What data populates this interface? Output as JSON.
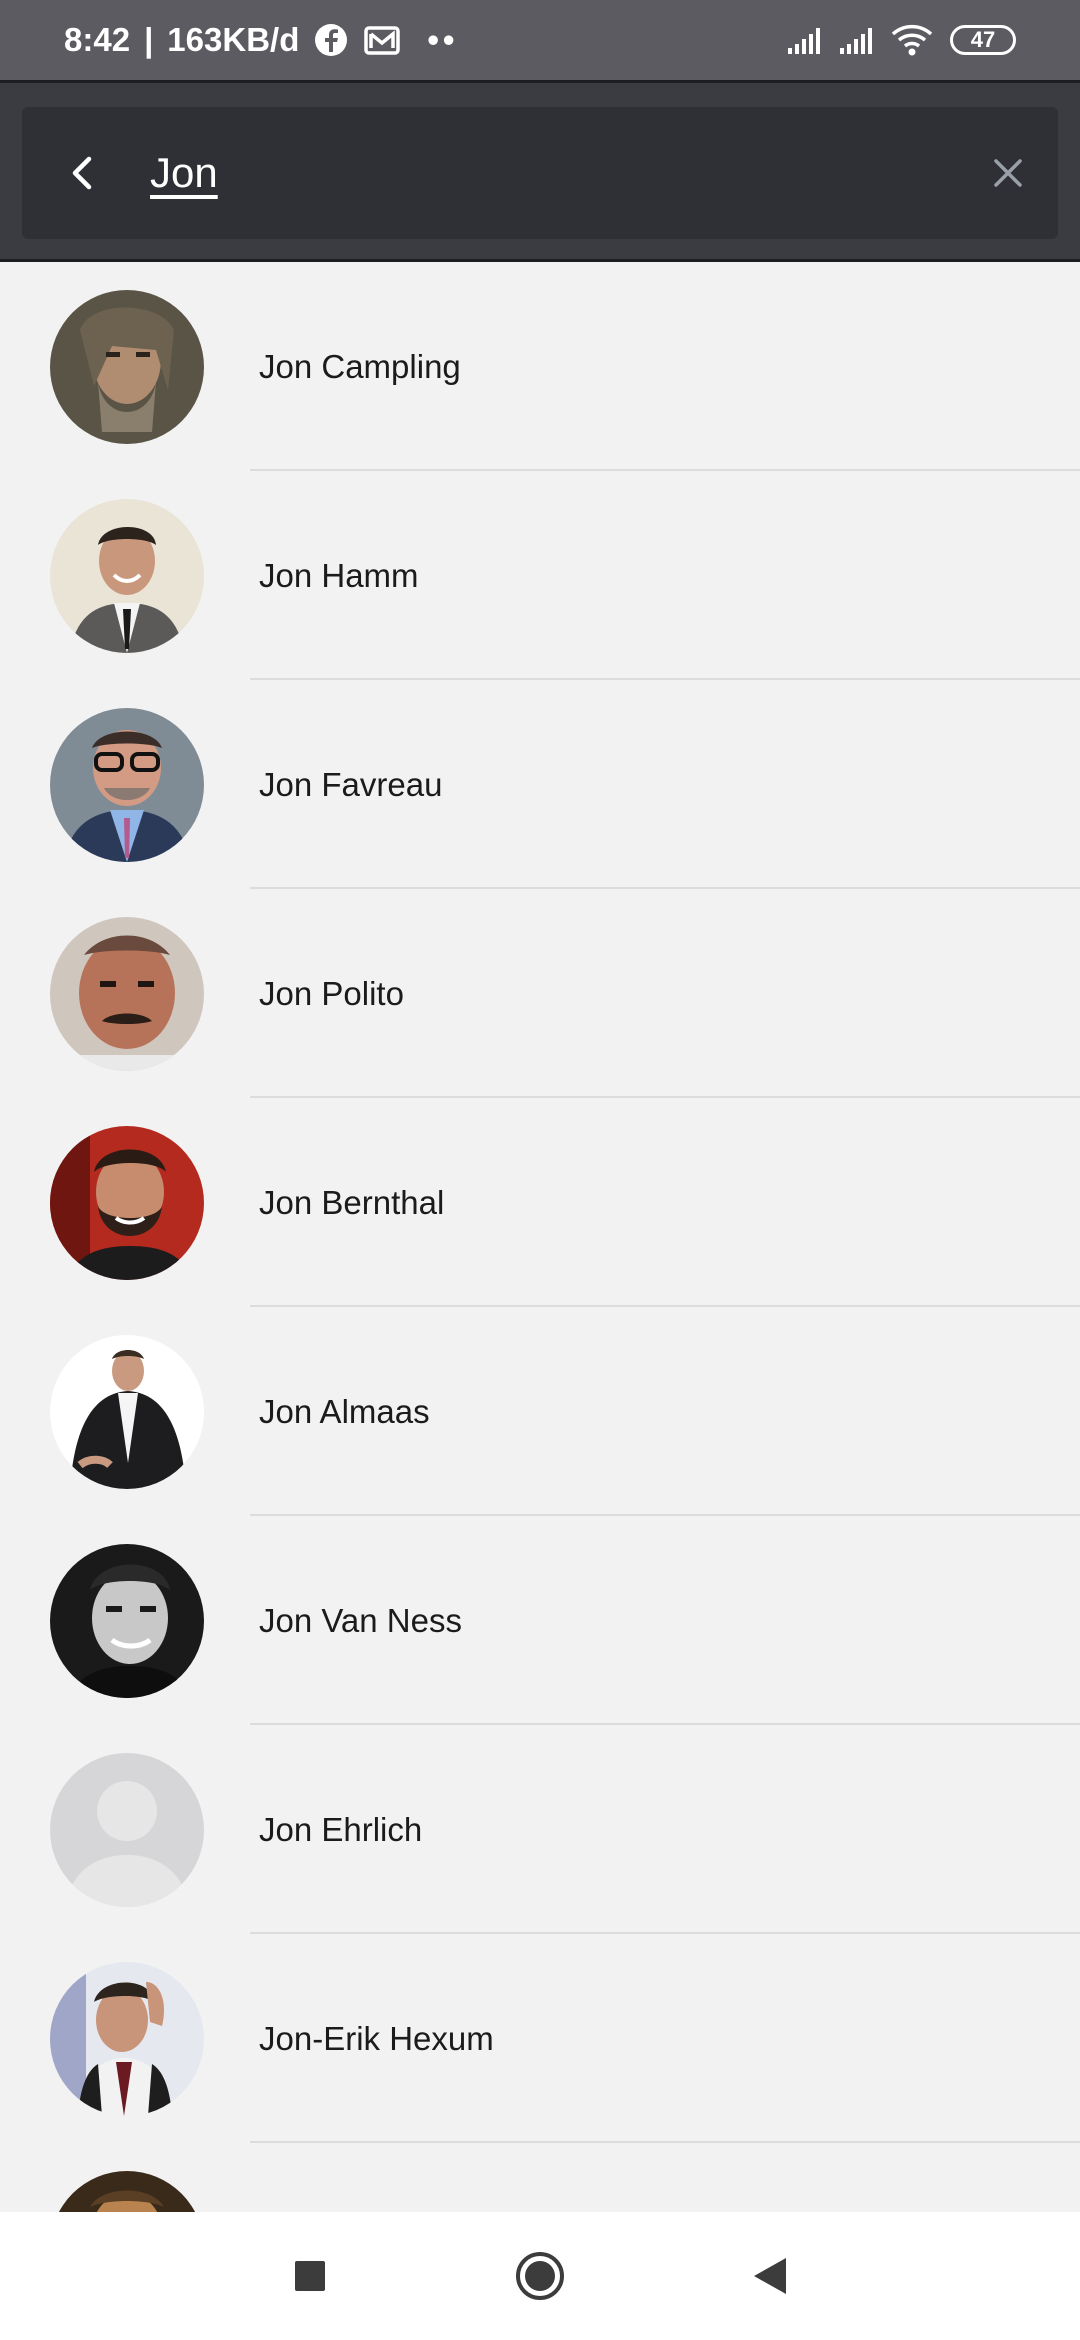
{
  "status_bar": {
    "time": "8:42",
    "separator": "|",
    "data_rate": "163KB/d",
    "dots": "••",
    "battery": "47"
  },
  "search": {
    "query": "Jon"
  },
  "results": [
    {
      "name": "Jon Campling",
      "avatar": "photo-long-haired-bearded-man"
    },
    {
      "name": "Jon Hamm",
      "avatar": "photo-man-suit-tie"
    },
    {
      "name": "Jon Favreau",
      "avatar": "photo-man-glasses"
    },
    {
      "name": "Jon Polito",
      "avatar": "photo-man-mustache"
    },
    {
      "name": "Jon Bernthal",
      "avatar": "photo-bearded-man-red-background"
    },
    {
      "name": "Jon Almaas",
      "avatar": "photo-man-dark-suit"
    },
    {
      "name": "Jon Van Ness",
      "avatar": "photo-man-black-and-white"
    },
    {
      "name": "Jon Ehrlich",
      "avatar": "placeholder-person-icon"
    },
    {
      "name": "Jon-Erik Hexum",
      "avatar": "photo-man-hand-on-head"
    },
    {
      "name": "",
      "avatar": "photo-partial"
    }
  ],
  "colors": {
    "status_bar": "#5b5b61",
    "header": "#3a3c42",
    "search_box": "#2e3035",
    "list_bg": "#f2f2f2"
  }
}
